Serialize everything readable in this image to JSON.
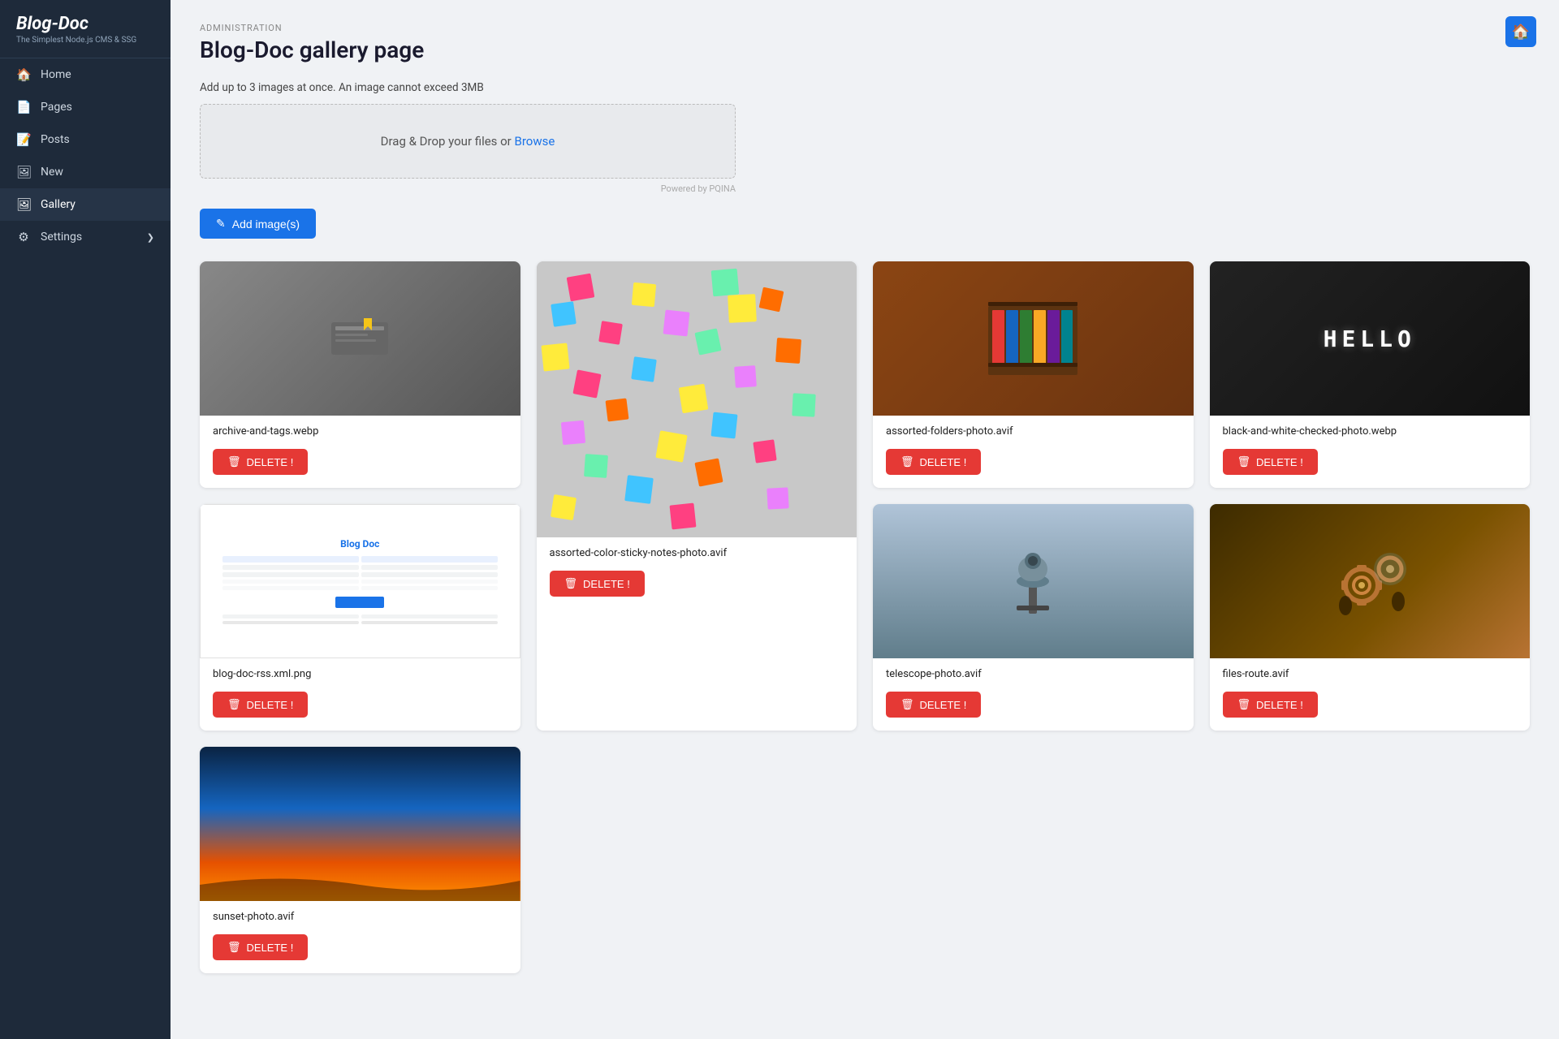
{
  "sidebar": {
    "logo": {
      "title": "Blog-Doc",
      "subtitle": "The Simplest Node.js CMS & SSG"
    },
    "items": [
      {
        "id": "home",
        "label": "Home",
        "icon": "🏠"
      },
      {
        "id": "pages",
        "label": "Pages",
        "icon": "📄"
      },
      {
        "id": "posts",
        "label": "Posts",
        "icon": "📝"
      },
      {
        "id": "new",
        "label": "New",
        "icon": "🖼"
      },
      {
        "id": "gallery",
        "label": "Gallery",
        "icon": "🖼"
      },
      {
        "id": "settings",
        "label": "Settings",
        "icon": "⚙",
        "arrow": "❯"
      }
    ]
  },
  "header": {
    "admin_label": "ADMINISTRATION",
    "page_title": "Blog-Doc gallery page"
  },
  "upload": {
    "info": "Add up to 3 images at once. An image cannot exceed 3MB",
    "dropzone_text": "Drag & Drop your files or",
    "dropzone_link": "Browse",
    "powered_by": "Powered by PQINA",
    "add_button": "Add image(s)"
  },
  "gallery": {
    "images": [
      {
        "id": "1",
        "filename": "archive-and-tags.webp",
        "delete_label": "DELETE !"
      },
      {
        "id": "2",
        "filename": "assorted-color-sticky-notes-photo.avif",
        "delete_label": "DELETE !"
      },
      {
        "id": "3",
        "filename": "assorted-folders-photo.avif",
        "delete_label": "DELETE !"
      },
      {
        "id": "4",
        "filename": "black-and-white-checked-photo.webp",
        "delete_label": "DELETE !"
      },
      {
        "id": "5",
        "filename": "blog-doc-rss.xml.png",
        "delete_label": "DELETE !"
      },
      {
        "id": "6",
        "filename": "telescope-photo.avif",
        "delete_label": "DELETE !"
      },
      {
        "id": "7",
        "filename": "files-route.avif",
        "delete_label": "DELETE !"
      },
      {
        "id": "8",
        "filename": "sunset-photo.avif",
        "delete_label": "DELETE !"
      }
    ]
  },
  "home_button": "🏠"
}
